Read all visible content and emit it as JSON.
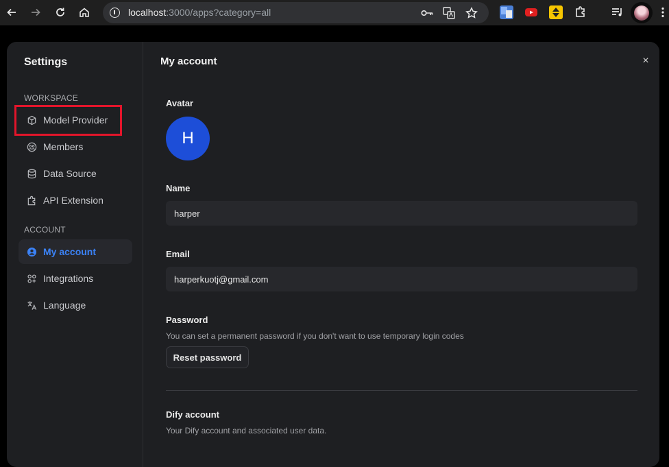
{
  "browser": {
    "url_host": "localhost",
    "url_path": ":3000/apps?category=all"
  },
  "sidebar": {
    "title": "Settings",
    "workspace_label": "WORKSPACE",
    "account_label": "ACCOUNT",
    "workspace_items": [
      {
        "label": "Model Provider"
      },
      {
        "label": "Members"
      },
      {
        "label": "Data Source"
      },
      {
        "label": "API Extension"
      }
    ],
    "account_items": [
      {
        "label": "My account"
      },
      {
        "label": "Integrations"
      },
      {
        "label": "Language"
      }
    ]
  },
  "main": {
    "title": "My account",
    "close_label": "×",
    "avatar_label": "Avatar",
    "avatar_initial": "H",
    "name_label": "Name",
    "name_value": "harper",
    "email_label": "Email",
    "email_value": "harperkuotj@gmail.com",
    "password_label": "Password",
    "password_hint": "You can set a permanent password if you don't want to use temporary login codes",
    "reset_button": "Reset password",
    "dify_label": "Dify account",
    "dify_hint": "Your Dify account and associated user data."
  },
  "colors": {
    "accent": "#3b82f6",
    "avatar_bg": "#1d4ed8",
    "highlight": "#e3152b"
  }
}
